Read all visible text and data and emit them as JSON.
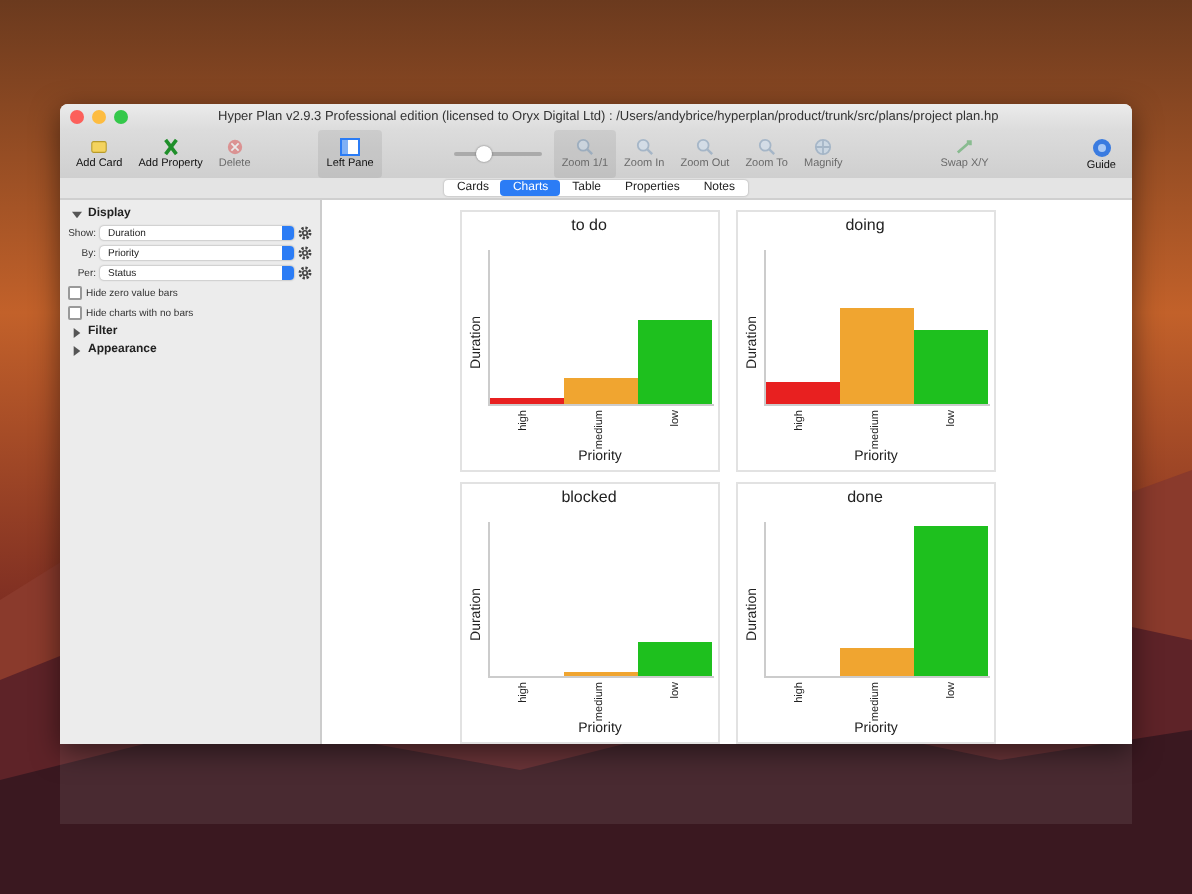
{
  "window": {
    "title": "Hyper Plan v2.9.3 Professional edition (licensed to Oryx Digital Ltd) : /Users/andybrice/hyperplan/product/trunk/src/plans/project plan.hp"
  },
  "toolbar": [
    {
      "label": "Add Card",
      "kind": "card",
      "disabled": false,
      "selected": false
    },
    {
      "label": "Add Property",
      "kind": "property",
      "disabled": false,
      "selected": false
    },
    {
      "label": "Delete",
      "kind": "delete",
      "disabled": true,
      "selected": false
    },
    {
      "label": "Left Pane",
      "kind": "pane",
      "disabled": false,
      "selected": true
    },
    {
      "kind": "slider",
      "level": 0.35
    },
    {
      "label": "Zoom 1/1",
      "kind": "zoom",
      "disabled": true,
      "selected": true
    },
    {
      "label": "Zoom In",
      "kind": "zoom",
      "disabled": true,
      "selected": false
    },
    {
      "label": "Zoom Out",
      "kind": "zoom",
      "disabled": true,
      "selected": false
    },
    {
      "label": "Zoom To",
      "kind": "zoom",
      "disabled": true,
      "selected": false
    },
    {
      "label": "Magnify",
      "kind": "magnify",
      "disabled": true,
      "selected": false
    },
    {
      "label": "Swap X/Y",
      "kind": "swap",
      "disabled": true,
      "selected": false
    },
    {
      "label": "Guide",
      "kind": "guide",
      "disabled": false,
      "selected": false
    }
  ],
  "tabs": [
    {
      "label": "Cards",
      "selected": false
    },
    {
      "label": "Charts",
      "selected": true
    },
    {
      "label": "Table",
      "selected": false
    },
    {
      "label": "Properties",
      "selected": false
    },
    {
      "label": "Notes",
      "selected": false
    }
  ],
  "sidebar": {
    "sections": [
      {
        "label": "Display",
        "expanded": true
      },
      {
        "label": "Filter",
        "expanded": false
      },
      {
        "label": "Appearance",
        "expanded": false
      }
    ],
    "selects": [
      {
        "label": "Show:",
        "value": "Duration"
      },
      {
        "label": "By:",
        "value": "Priority"
      },
      {
        "label": "Per:",
        "value": "Status"
      }
    ],
    "checkboxes": [
      {
        "label": "Hide zero value bars",
        "checked": false
      },
      {
        "label": "Hide charts with no bars",
        "checked": false
      }
    ]
  },
  "charts": [
    {
      "title": "to do",
      "xlabel": "Priority",
      "ylabel": "Duration",
      "categories": [
        "high",
        "medium",
        "low"
      ]
    },
    {
      "title": "doing",
      "xlabel": "Priority",
      "ylabel": "Duration",
      "categories": [
        "high",
        "medium",
        "low"
      ]
    },
    {
      "title": "blocked",
      "xlabel": "Priority",
      "ylabel": "Duration",
      "categories": [
        "high",
        "medium",
        "low"
      ]
    },
    {
      "title": "done",
      "xlabel": "Priority",
      "ylabel": "Duration",
      "categories": [
        "high",
        "medium",
        "low"
      ]
    }
  ]
}
